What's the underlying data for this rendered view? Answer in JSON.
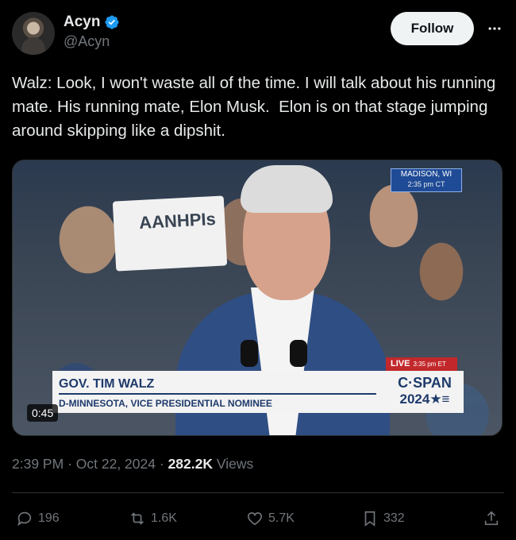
{
  "author": {
    "display_name": "Acyn",
    "handle": "@Acyn",
    "verified_icon": "verified-badge-icon"
  },
  "follow_label": "Follow",
  "tweet": {
    "text": "Walz: Look, I won't waste all of the time. I will talk about his running mate. His running mate, Elon Musk.  Elon is on that stage jumping around skipping like a dipshit."
  },
  "video": {
    "duration": "0:45",
    "sign_text": "AANHPIs",
    "location_badge": "MADISON, WI",
    "location_time": "2:35 pm CT",
    "live_label": "LIVE",
    "live_time": "3:35 pm ET",
    "lower_third_name": "GOV. TIM WALZ",
    "lower_third_title": "D-MINNESOTA, VICE PRESIDENTIAL NOMINEE",
    "network_top": "C·SPAN",
    "network_bottom": "2024★≡"
  },
  "meta": {
    "time": "2:39 PM",
    "date": "Oct 22, 2024",
    "views_count": "282.2K",
    "views_label": "Views"
  },
  "actions": {
    "replies": "196",
    "reposts": "1.6K",
    "likes": "5.7K",
    "bookmarks": "332"
  },
  "colors": {
    "background": "#000000",
    "text": "#e7e9ea",
    "muted": "#71767b",
    "verified": "#1d9bf0",
    "follow_bg": "#eff3f4"
  }
}
